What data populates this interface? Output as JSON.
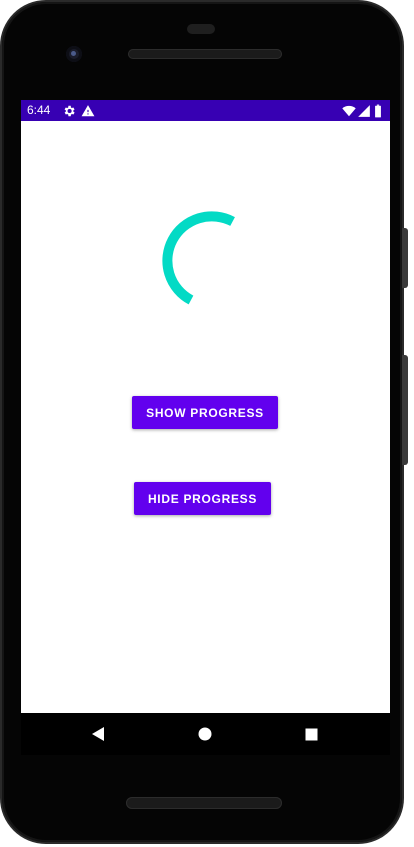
{
  "status_bar": {
    "time": "6:44",
    "background_color": "#3700b3",
    "left_icons": [
      "gear-icon",
      "warning-icon"
    ],
    "right_icons": [
      "wifi-icon",
      "cellular-signal-icon",
      "battery-icon"
    ]
  },
  "progress_indicator": {
    "type": "circular-indeterminate",
    "color": "#03dac5",
    "visible": true
  },
  "buttons": {
    "show_progress_label": "SHOW PROGRESS",
    "hide_progress_label": "HIDE PROGRESS",
    "color": "#6200ee"
  },
  "navigation_bar": {
    "items": [
      "back-icon",
      "home-icon",
      "recents-icon"
    ]
  }
}
